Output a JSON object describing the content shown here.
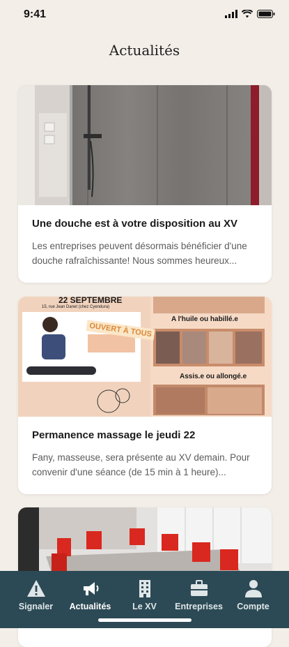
{
  "status_bar": {
    "time": "9:41"
  },
  "page": {
    "title": "Actualités"
  },
  "articles": [
    {
      "title": "Une douche est à votre disposition au XV",
      "excerpt": "Les entreprises peuvent désormais bénéficier d'une douche rafraîchissante! Nous sommes heureux..."
    },
    {
      "title": "Permanence massage le jeudi 22",
      "excerpt": "Fany, masseuse, sera présente au XV demain. Pour convenir d'une séance (de 15 min à 1 heure)...",
      "poster": {
        "date": "22 SEPTEMBRE",
        "address": "15, rue Jean Danet (chez Cyendura)",
        "stamp": "OUVERT À TOUS",
        "label1": "A l'huile ou habillé.e",
        "label2": "Assis.e ou allongé.e"
      }
    }
  ],
  "nav": {
    "items": [
      {
        "label": "Signaler",
        "icon": "warning-icon"
      },
      {
        "label": "Actualités",
        "icon": "megaphone-icon"
      },
      {
        "label": "Le XV",
        "icon": "building-icon"
      },
      {
        "label": "Entreprises",
        "icon": "briefcase-icon"
      },
      {
        "label": "Compte",
        "icon": "person-icon"
      }
    ],
    "active": "Actualités"
  }
}
